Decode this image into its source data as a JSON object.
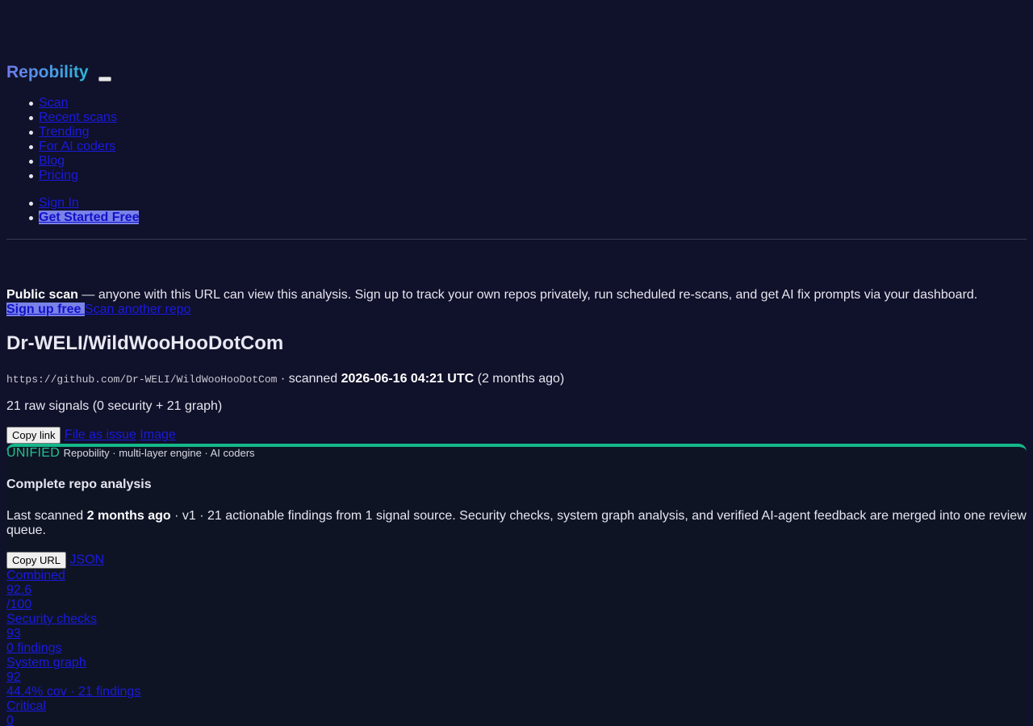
{
  "header": {
    "brand": "Repobility",
    "nav": [
      "Scan",
      "Recent scans",
      "Trending",
      "For AI coders",
      "Blog",
      "Pricing"
    ],
    "sign_in": "Sign In",
    "get_started": "Get Started Free"
  },
  "banner": {
    "label": "Public scan",
    "text": " — anyone with this URL can view this analysis. Sign up to track your own repos privately, run scheduled re-scans, and get AI fix prompts via your dashboard.",
    "signup": "Sign up free ",
    "scan_another": "Scan another repo"
  },
  "repo": {
    "title": "Dr-WELI/WildWooHooDotCom",
    "url": "https://github.com/Dr-WELI/WildWooHooDotCom",
    "scanned_prefix": " · scanned ",
    "scanned_at": "2026-06-16 04:21 UTC",
    "scanned_ago": " (2 months ago)",
    "signals": "21 raw signals (0 security + 21 graph)"
  },
  "actions": {
    "copy_link": "Copy link",
    "file_issue": "File as issue",
    "image": "Image"
  },
  "card": {
    "badge": "UNIFIED",
    "badge_sub": "Repobility · multi-layer engine · AI coders",
    "title": "Complete repo analysis",
    "desc_prefix": "Last scanned ",
    "desc_bold": "2 months ago",
    "desc_rest": " · v1 · 21 actionable findings from 1 signal source. Security checks, system graph analysis, and verified AI-agent feedback are merged into one review queue.",
    "copy_url": "Copy URL",
    "json": "JSON",
    "stats": [
      "Combined",
      "92.6",
      "/100",
      "Security checks",
      "93",
      "0 findings",
      "System graph",
      "92",
      "44.4% cov · 21 findings",
      "Critical",
      "0"
    ]
  }
}
